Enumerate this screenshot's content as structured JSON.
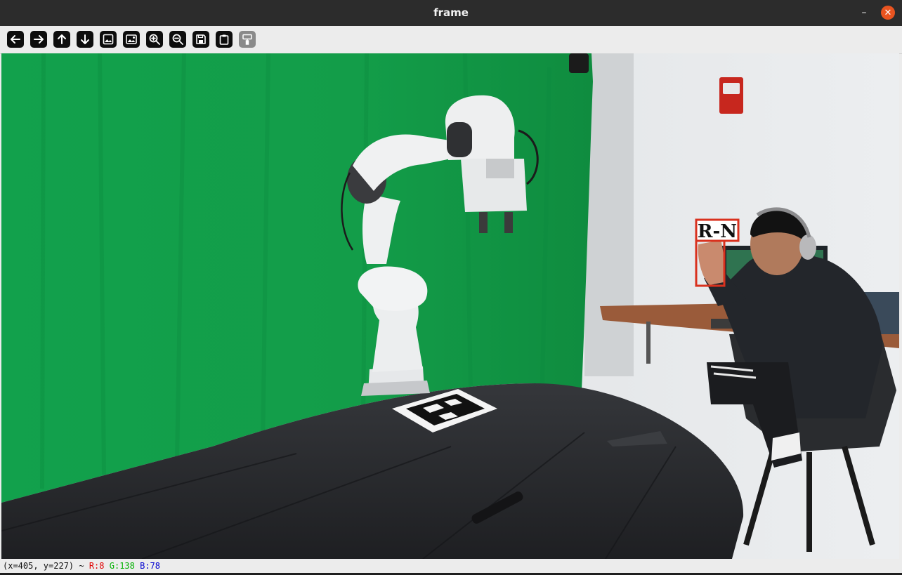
{
  "window": {
    "title": "frame",
    "minimize_glyph": "–",
    "close_glyph": "✕"
  },
  "toolbar": {
    "buttons": [
      {
        "name": "pan-left",
        "icon": "arrow-left-icon"
      },
      {
        "name": "pan-right",
        "icon": "arrow-right-icon"
      },
      {
        "name": "pan-up",
        "icon": "arrow-up-icon"
      },
      {
        "name": "pan-down",
        "icon": "arrow-down-icon"
      },
      {
        "name": "zoom-fit",
        "icon": "image-icon"
      },
      {
        "name": "zoom-original",
        "icon": "image-detail-icon"
      },
      {
        "name": "zoom-in",
        "icon": "zoom-in-icon"
      },
      {
        "name": "zoom-out",
        "icon": "zoom-out-icon"
      },
      {
        "name": "save",
        "icon": "floppy-disk-icon"
      },
      {
        "name": "copy-clipboard",
        "icon": "clipboard-icon"
      },
      {
        "name": "properties",
        "icon": "paint-brush-icon"
      }
    ]
  },
  "overlay": {
    "label": "R-N",
    "box_color": "#d9311e"
  },
  "status": {
    "coords": "(x=405, y=227) ~",
    "r": "R:8",
    "g": "G:138",
    "b": "B:78",
    "r_color": "#e00000",
    "g_color": "#00b000",
    "b_color": "#0000d0"
  },
  "colors": {
    "greenscreen": "#12a04a",
    "table": "#2a2b2e",
    "close_button": "#e95420"
  }
}
